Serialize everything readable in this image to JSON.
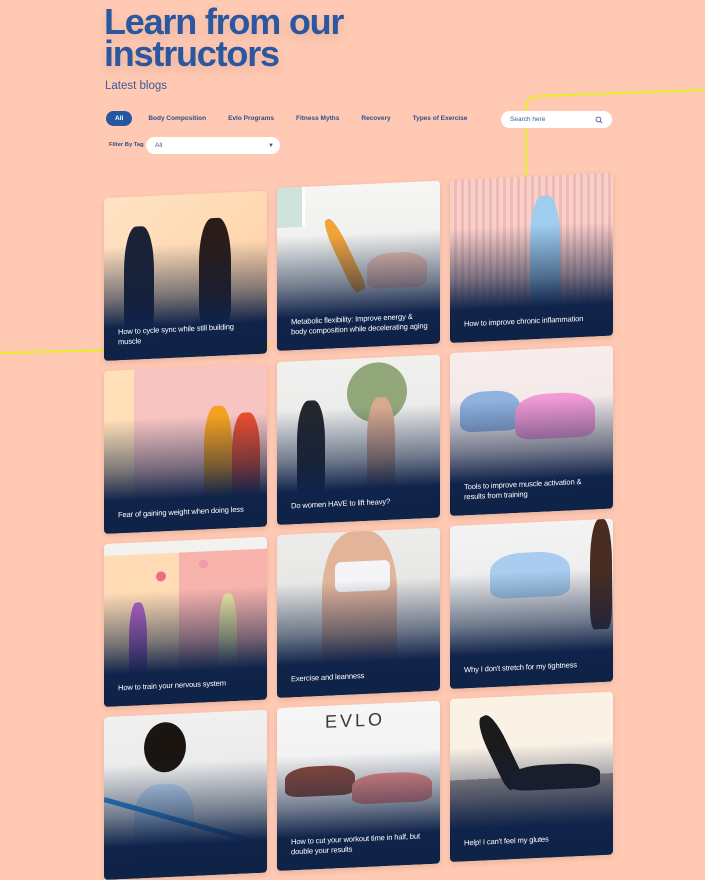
{
  "header": {
    "title_line1": "Learn from our",
    "title_line2": "instructors",
    "subtitle": "Latest blogs"
  },
  "categories": [
    {
      "label": "All",
      "active": true
    },
    {
      "label": "Body Composition",
      "active": false
    },
    {
      "label": "Evlo Programs",
      "active": false
    },
    {
      "label": "Fitness Myths",
      "active": false
    },
    {
      "label": "Recovery",
      "active": false
    },
    {
      "label": "Types of Exercise",
      "active": false
    }
  ],
  "search": {
    "placeholder": "Search here",
    "value": "",
    "icon": "search-icon"
  },
  "filter": {
    "label": "Filter By Tag",
    "selected": "All",
    "icon": "caret-down-icon"
  },
  "colors": {
    "background": "#ffc9b3",
    "accent": "#2556a0",
    "title": "#2a57a0",
    "card_overlay": "#10234a",
    "decor_line": "#e5f020"
  },
  "posts": [
    {
      "title": "How to cycle sync while still building muscle",
      "photo": "two women doing lunges with dumbbells"
    },
    {
      "title": "Metabolic flexibility: Improve energy & body composition while decelerating aging",
      "photo": "woman doing leg raise on floor"
    },
    {
      "title": "How to improve chronic inflammation",
      "photo": "woman squatting with arms extended"
    },
    {
      "title": "Fear of gaining weight when doing less",
      "photo": "two women smiling in workout sets"
    },
    {
      "title": "Do women HAVE to lift heavy?",
      "photo": "two women stepping up"
    },
    {
      "title": "Tools to improve muscle activation & results from training",
      "photo": "two women doing kneeling side plank with dumbbells"
    },
    {
      "title": "How to train your nervous system",
      "photo": "two women throwing balls"
    },
    {
      "title": "Exercise and leanness",
      "photo": "woman in white sports bra with hands on hips"
    },
    {
      "title": "Why I don't stretch for my tightness",
      "photo": "woman in blue set on all fours"
    },
    {
      "title": "",
      "photo": "woman stretching resistance band"
    },
    {
      "title": "How to cut your workout time in half, but double your results",
      "photo": "two women in side plank with EVLO logo"
    },
    {
      "title": "Help! I can't feel my glutes",
      "photo": "woman doing donkey kick on beach"
    }
  ]
}
